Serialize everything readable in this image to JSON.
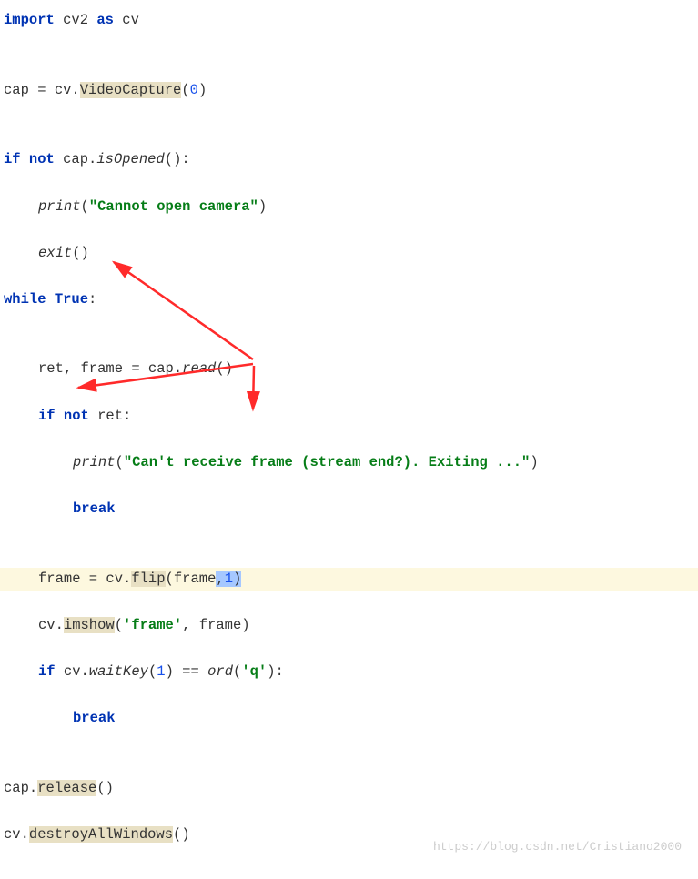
{
  "code": {
    "l1": {
      "kw_import": "import",
      "mod": "cv2",
      "kw_as": "as",
      "alias": "cv"
    },
    "l3": {
      "var": "cap",
      "eq": " = ",
      "obj": "cv.",
      "call": "VideoCapture",
      "lp": "(",
      "arg": "0",
      "rp": ")"
    },
    "l5": {
      "kw_if": "if",
      "kw_not": "not",
      "obj": " cap.",
      "call": "isOpened",
      "parens": "():"
    },
    "l6": {
      "fn": "print",
      "lp": "(",
      "str": "\"Cannot open camera\"",
      "rp": ")"
    },
    "l7": {
      "fn": "exit",
      "parens": "()"
    },
    "l8": {
      "kw_while": "while",
      "sp": " ",
      "val": "True",
      "colon": ":"
    },
    "l10": {
      "lhs": "ret, frame = cap.",
      "call": "read",
      "parens": "()"
    },
    "l11": {
      "kw_if": "if",
      "sp": " ",
      "kw_not": "not",
      "rest": " ret:"
    },
    "l12": {
      "fn": "print",
      "lp": "(",
      "str": "\"Can't receive frame (stream end?). Exiting ...\"",
      "rp": ")"
    },
    "l13": {
      "kw": "break"
    },
    "l15": {
      "lhs": "frame = cv.",
      "call": "flip",
      "lp": "(",
      "arg1": "frame",
      "sel_comma": ",",
      "sel_arg2": "1",
      "rp": ")"
    },
    "l16": {
      "obj": "cv.",
      "call": "imshow",
      "lp": "(",
      "str": "'frame'",
      "comma": ", frame)",
      "rp": ""
    },
    "l17": {
      "kw_if": "if",
      "rest1": " cv.",
      "call": "waitKey",
      "lp": "(",
      "num": "1",
      "mid": ") == ",
      "fn": "ord",
      "lp2": "(",
      "str": "'q'",
      "rp2": "):"
    },
    "l18": {
      "kw": "break"
    },
    "l20": {
      "obj": "cap.",
      "call": "release",
      "parens": "()"
    },
    "l21": {
      "obj": "cv.",
      "call": "destroyAllWindows",
      "parens": "()"
    }
  },
  "watermark": "https://blog.csdn.net/Cristiano2000"
}
